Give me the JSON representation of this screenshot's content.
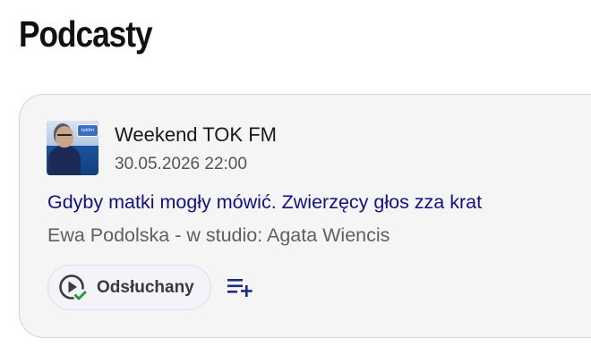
{
  "page": {
    "title": "Podcasty"
  },
  "podcast_card": {
    "cover_icon": "podcast-cover-image",
    "cover_text": "tokfm",
    "show_name": "Weekend TOK FM",
    "date": "30.05.2026 22:00",
    "episode_title": "Gdyby matki mogły mówić. Zwierzęcy głos zza krat",
    "authors": "Ewa Podolska - w studio: Agata Wiencis",
    "listened_button": {
      "label": "Odsłuchany",
      "icon": "play-listened-icon"
    },
    "queue_add_icon": "playlist-add-icon",
    "colors": {
      "title_link": "#10108c",
      "check_green": "#1f9d3a",
      "queue_icon": "#1a2a8c"
    }
  }
}
